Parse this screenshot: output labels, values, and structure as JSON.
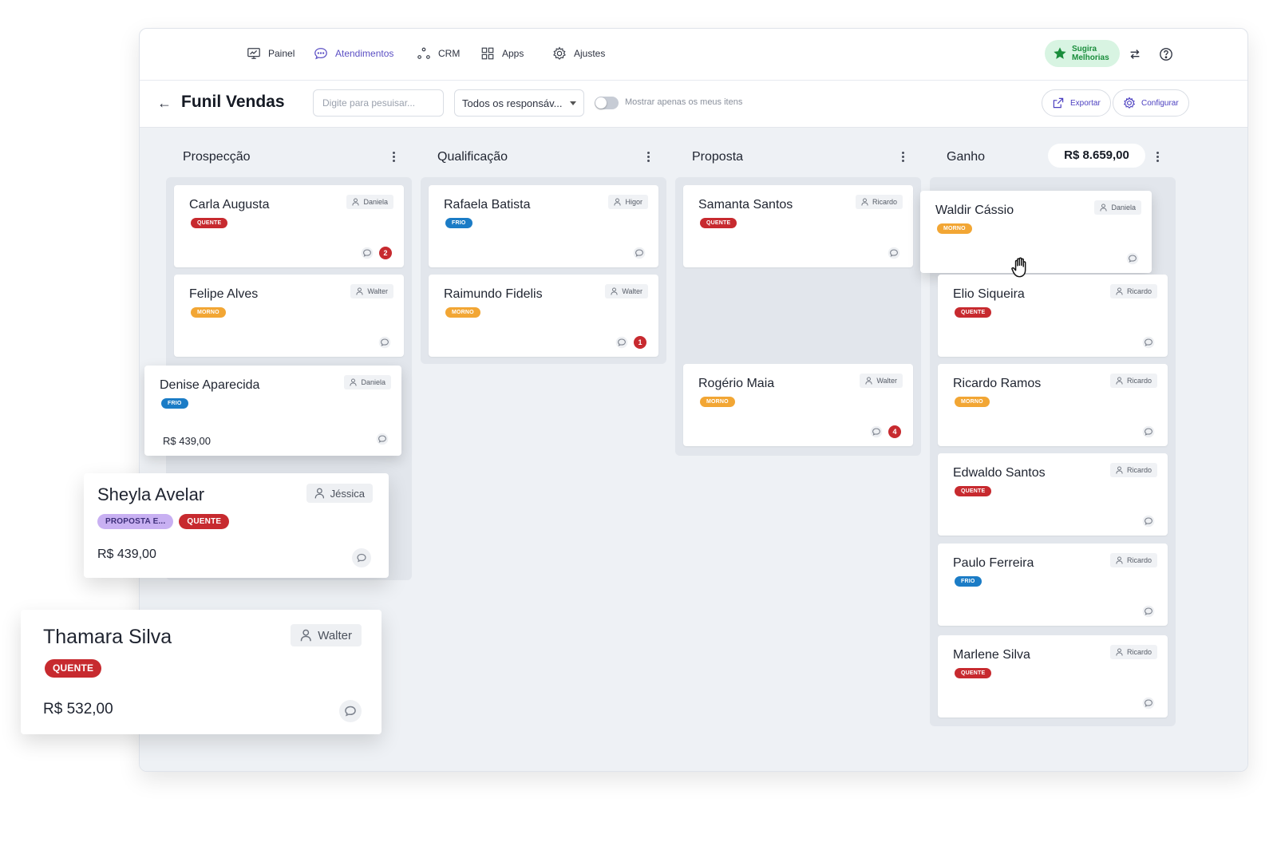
{
  "nav": {
    "items": [
      {
        "label": "Painel",
        "icon": "presentation-chart-icon"
      },
      {
        "label": "Atendimentos",
        "icon": "chat-bubble-icon",
        "active": true
      },
      {
        "label": "CRM",
        "icon": "nodes-icon"
      },
      {
        "label": "Apps",
        "icon": "grid-icon"
      },
      {
        "label": "Ajustes",
        "icon": "gear-icon"
      }
    ],
    "sugira": {
      "line1": "Sugira",
      "line2": "Melhorias"
    }
  },
  "subheader": {
    "title": "Funil Vendas",
    "search_placeholder": "Digite para pesuisar...",
    "responsavel": "Todos os responsáv...",
    "toggle_label": "Mostrar apenas os meus itens",
    "export_label": "Exportar",
    "config_label": "Configurar"
  },
  "columns": [
    {
      "title": "Prospecção"
    },
    {
      "title": "Qualificação"
    },
    {
      "title": "Proposta"
    },
    {
      "title": "Ganho",
      "total": "R$ 8.659,00"
    }
  ],
  "cards": [
    {
      "name": "Carla Augusta",
      "owner": "Daniela",
      "tags": [
        "QUENTE"
      ],
      "comments": "2"
    },
    {
      "name": "Felipe Alves",
      "owner": "Walter",
      "tags": [
        "MORNO"
      ]
    },
    {
      "name": "Denise Aparecida",
      "owner": "Daniela",
      "tags": [
        "FRIO"
      ],
      "value": "R$ 439,00"
    },
    {
      "name": "Rafaela Batista",
      "owner": "Higor",
      "tags": [
        "FRIO"
      ]
    },
    {
      "name": "Raimundo Fidelis",
      "owner": "Walter",
      "tags": [
        "MORNO"
      ],
      "comments": "1"
    },
    {
      "name": "Samanta Santos",
      "owner": "Ricardo",
      "tags": [
        "QUENTE"
      ]
    },
    {
      "name": "Rogério Maia",
      "owner": "Walter",
      "tags": [
        "MORNO"
      ],
      "comments": "4"
    },
    {
      "name": "Waldir Cássio",
      "owner": "Daniela",
      "tags": [
        "MORNO"
      ]
    },
    {
      "name": "Elio Siqueira",
      "owner": "Ricardo",
      "tags": [
        "QUENTE"
      ]
    },
    {
      "name": "Ricardo Ramos",
      "owner": "Ricardo",
      "tags": [
        "MORNO"
      ]
    },
    {
      "name": "Edwaldo Santos",
      "owner": "Ricardo",
      "tags": [
        "QUENTE"
      ]
    },
    {
      "name": "Paulo Ferreira",
      "owner": "Ricardo",
      "tags": [
        "FRIO"
      ]
    },
    {
      "name": "Marlene Silva",
      "owner": "Ricardo",
      "tags": [
        "QUENTE"
      ]
    }
  ],
  "floating": [
    {
      "name": "Sheyla Avelar",
      "owner": "Jéssica",
      "tags": [
        "PROPOSTA E...",
        "QUENTE"
      ],
      "value": "R$ 439,00"
    },
    {
      "name": "Thamara Silva",
      "owner": "Walter",
      "tags": [
        "QUENTE"
      ],
      "value": "R$ 532,00"
    }
  ],
  "colors": {
    "accent": "#5b4fc4",
    "quente": "#c72a2f",
    "morno": "#f2a634",
    "frio": "#1b7cc6",
    "proposta": "#c8b0f2"
  }
}
